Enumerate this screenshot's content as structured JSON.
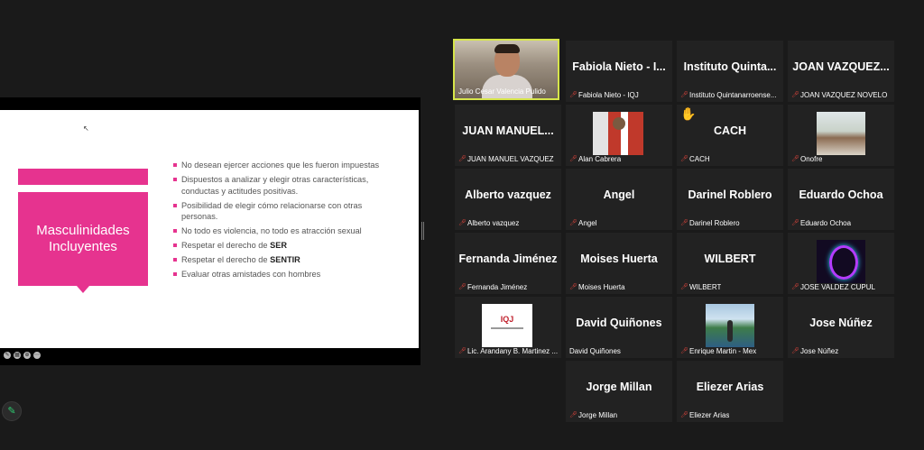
{
  "slide": {
    "title": "Masculinidades Incluyentes",
    "bullets": [
      {
        "text": "No desean ejercer acciones que les fueron impuestas"
      },
      {
        "text": "Dispuestos a analizar y elegir otras características, conductas y actitudes positivas."
      },
      {
        "text": "Posibilidad de elegir cómo relacionarse con otras personas."
      },
      {
        "text": "No todo es violencia, no todo es atracción sexual"
      },
      {
        "text": "Respetar el derecho de ",
        "bold": "SER"
      },
      {
        "text": "Respetar el derecho de ",
        "bold": "SENTIR"
      },
      {
        "text": "Evaluar otras amistades con hombres"
      }
    ]
  },
  "colors": {
    "accent": "#e6338f",
    "active_speaker": "#d6e54a",
    "muted_mic": "#e0443c"
  },
  "icons": {
    "muted": "mic-muted-icon",
    "raise_hand": "raised-hand-icon",
    "annotate": "pencil-icon"
  },
  "participants": [
    {
      "display": "",
      "label": "Julio Cesar Valencia Pulido"
    },
    {
      "display": "Fabiola Nieto - I...",
      "label": "Fabiola Nieto - IQJ"
    },
    {
      "display": "Instituto Quinta...",
      "label": "Instituto Quintanarroense..."
    },
    {
      "display": "JOAN VAZQUEZ...",
      "label": "JOAN VAZQUEZ NOVELO"
    },
    {
      "display": "JUAN MANUEL...",
      "label": "JUAN MANUEL VAZQUEZ"
    },
    {
      "display": "",
      "label": "Alan Cabrera"
    },
    {
      "display": "CACH",
      "label": "CACH"
    },
    {
      "display": "",
      "label": "Onofre"
    },
    {
      "display": "Alberto vazquez",
      "label": "Alberto vazquez"
    },
    {
      "display": "Angel",
      "label": "Angel"
    },
    {
      "display": "Darinel Roblero",
      "label": "Darinel Roblero"
    },
    {
      "display": "Eduardo Ochoa",
      "label": "Eduardo Ochoa"
    },
    {
      "display": "Fernanda Jiménez",
      "label": "Fernanda Jiménez"
    },
    {
      "display": "Moises Huerta",
      "label": "Moises Huerta"
    },
    {
      "display": "WILBERT",
      "label": "WILBERT"
    },
    {
      "display": "",
      "label": "JOSE VALDEZ CUPUL"
    },
    {
      "display": "",
      "label": "Lic. Arandany B. Martinez ..."
    },
    {
      "display": "David Quiñones",
      "label": "David Quiñones"
    },
    {
      "display": "",
      "label": "Enrique Martin - Mex"
    },
    {
      "display": "Jose Núñez",
      "label": "Jose Núñez"
    },
    {
      "display": "Jorge Millan",
      "label": "Jorge Millan"
    },
    {
      "display": "Eliezer Arias",
      "label": "Eliezer Arias"
    }
  ],
  "logo_iqj": "IQJ"
}
